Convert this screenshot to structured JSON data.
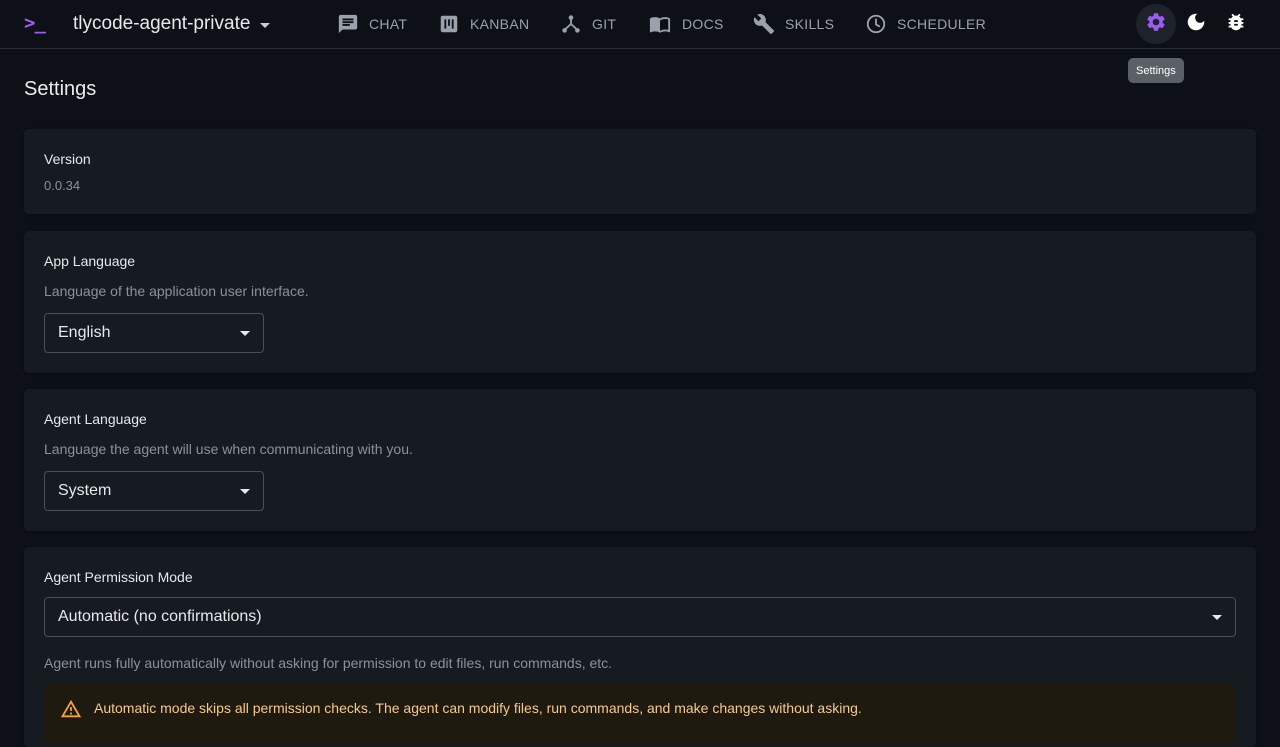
{
  "header": {
    "logo_text": ">_",
    "project_name": "tlycode-agent-private",
    "nav": [
      {
        "label": "CHAT",
        "icon": "chat-icon"
      },
      {
        "label": "KANBAN",
        "icon": "kanban-icon"
      },
      {
        "label": "GIT",
        "icon": "git-icon"
      },
      {
        "label": "DOCS",
        "icon": "docs-icon"
      },
      {
        "label": "SKILLS",
        "icon": "skills-icon"
      },
      {
        "label": "SCHEDULER",
        "icon": "clock-icon"
      }
    ],
    "actions": [
      {
        "name": "settings",
        "icon": "gear-icon",
        "active": true
      },
      {
        "name": "theme",
        "icon": "moon-icon"
      },
      {
        "name": "debug",
        "icon": "bug-icon"
      }
    ],
    "tooltip": "Settings"
  },
  "colors": {
    "accent": "#9c5cf2",
    "background": "#0d1117",
    "card": "#161b22",
    "warning_bg": "#1f1a10",
    "warning_text": "#f5c98a",
    "warning_icon": "#f0a53a"
  },
  "page": {
    "title": "Settings"
  },
  "version": {
    "label": "Version",
    "value": "0.0.34"
  },
  "app_language": {
    "label": "App Language",
    "description": "Language of the application user interface.",
    "selected": "English"
  },
  "agent_language": {
    "label": "Agent Language",
    "description": "Language the agent will use when communicating with you.",
    "selected": "System"
  },
  "permission_mode": {
    "label": "Agent Permission Mode",
    "selected": "Automatic (no confirmations)",
    "description": "Agent runs fully automatically without asking for permission to edit files, run commands, etc.",
    "warning": "Automatic mode skips all permission checks. The agent can modify files, run commands, and make changes without asking."
  }
}
